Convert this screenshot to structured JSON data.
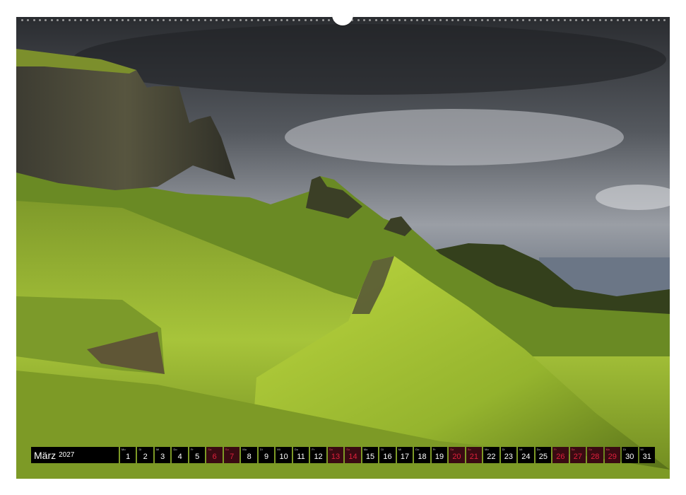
{
  "calendar": {
    "month": "März",
    "year": "2027",
    "days": [
      {
        "wd": "Mo",
        "num": "1",
        "weekend": false
      },
      {
        "wd": "Di",
        "num": "2",
        "weekend": false
      },
      {
        "wd": "Mi",
        "num": "3",
        "weekend": false
      },
      {
        "wd": "Do",
        "num": "4",
        "weekend": false
      },
      {
        "wd": "Fr",
        "num": "5",
        "weekend": false
      },
      {
        "wd": "Sa",
        "num": "6",
        "weekend": true
      },
      {
        "wd": "So",
        "num": "7",
        "weekend": true
      },
      {
        "wd": "Mo",
        "num": "8",
        "weekend": false
      },
      {
        "wd": "Di",
        "num": "9",
        "weekend": false
      },
      {
        "wd": "Mi",
        "num": "10",
        "weekend": false
      },
      {
        "wd": "Do",
        "num": "11",
        "weekend": false
      },
      {
        "wd": "Fr",
        "num": "12",
        "weekend": false
      },
      {
        "wd": "Sa",
        "num": "13",
        "weekend": true
      },
      {
        "wd": "So",
        "num": "14",
        "weekend": true
      },
      {
        "wd": "Mo",
        "num": "15",
        "weekend": false
      },
      {
        "wd": "Di",
        "num": "16",
        "weekend": false
      },
      {
        "wd": "Mi",
        "num": "17",
        "weekend": false
      },
      {
        "wd": "Do",
        "num": "18",
        "weekend": false
      },
      {
        "wd": "Fr",
        "num": "19",
        "weekend": false
      },
      {
        "wd": "Sa",
        "num": "20",
        "weekend": true
      },
      {
        "wd": "So",
        "num": "21",
        "weekend": true
      },
      {
        "wd": "Mo",
        "num": "22",
        "weekend": false
      },
      {
        "wd": "Di",
        "num": "23",
        "weekend": false
      },
      {
        "wd": "Mi",
        "num": "24",
        "weekend": false
      },
      {
        "wd": "Do",
        "num": "25",
        "weekend": false
      },
      {
        "wd": "Fr",
        "num": "26",
        "weekend": true
      },
      {
        "wd": "Sa",
        "num": "27",
        "weekend": true
      },
      {
        "wd": "So",
        "num": "28",
        "weekend": true
      },
      {
        "wd": "Mo",
        "num": "29",
        "weekend": true
      },
      {
        "wd": "Di",
        "num": "30",
        "weekend": false
      },
      {
        "wd": "Mi",
        "num": "31",
        "weekend": false
      }
    ]
  },
  "colors": {
    "weekday_bg": "#000000",
    "weekend_text": "#e0203c",
    "sky_dark": "#2f3236",
    "grass_light": "#b5cc3a"
  },
  "photo": {
    "subject": "mountain-landscape-photo"
  }
}
